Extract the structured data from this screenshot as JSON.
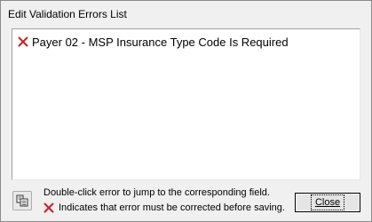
{
  "window": {
    "title": "Edit Validation Errors List"
  },
  "errors": {
    "items": [
      {
        "icon": "error-x-icon",
        "text": "Payer 02 - MSP Insurance Type Code Is Required"
      }
    ]
  },
  "footer": {
    "copy_icon": "copy-icon",
    "hint_line1": "Double-click error to jump to the corresponding field.",
    "hint_line2": "Indicates that error must be corrected before saving.",
    "close_label": "Close"
  },
  "colors": {
    "error_red": "#cc1f1f",
    "window_bg": "#f0f0f0"
  }
}
